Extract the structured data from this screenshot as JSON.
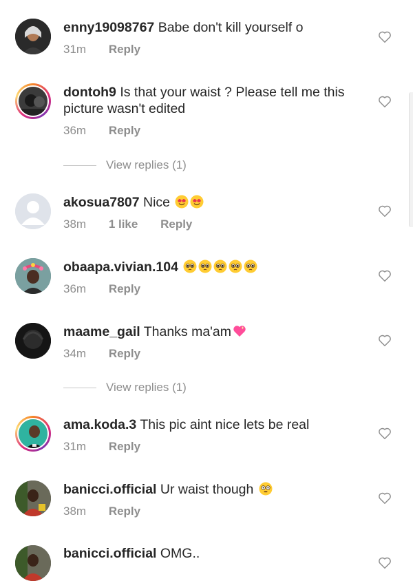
{
  "comments": [
    {
      "username": "enny19098767",
      "text": "Babe don't kill yourself o",
      "time": "31m",
      "reply": "Reply"
    },
    {
      "username": "dontoh9",
      "text": "Is that your waist ? Please tell me this picture wasn't edited",
      "time": "36m",
      "reply": "Reply",
      "view_replies": "View replies (1)"
    },
    {
      "username": "akosua7807",
      "text": "Nice",
      "emoji": [
        "smiling-heart-eyes",
        "smiling-heart-eyes"
      ],
      "time": "38m",
      "likes": "1 like",
      "reply": "Reply"
    },
    {
      "username": "obaapa.vivian.104",
      "text": "",
      "emoji": [
        "pleading-face",
        "pleading-face",
        "pleading-face",
        "pleading-face",
        "pleading-face"
      ],
      "time": "36m",
      "reply": "Reply"
    },
    {
      "username": "maame_gail",
      "text": "Thanks ma'am",
      "emoji": [
        "sparkling-heart"
      ],
      "time": "34m",
      "reply": "Reply",
      "view_replies": "View replies (1)"
    },
    {
      "username": "ama.koda.3",
      "text": "This pic aint nice lets be real",
      "time": "31m",
      "reply": "Reply"
    },
    {
      "username": "banicci.official",
      "text": "Ur waist though",
      "emoji": [
        "flushed-face"
      ],
      "time": "38m",
      "reply": "Reply"
    },
    {
      "username": "banicci.official",
      "text": "OMG..",
      "time": "",
      "reply": ""
    }
  ],
  "colors": {
    "text": "#262626",
    "meta": "#8e8e8e",
    "heart_stroke": "#8e8e8e"
  }
}
